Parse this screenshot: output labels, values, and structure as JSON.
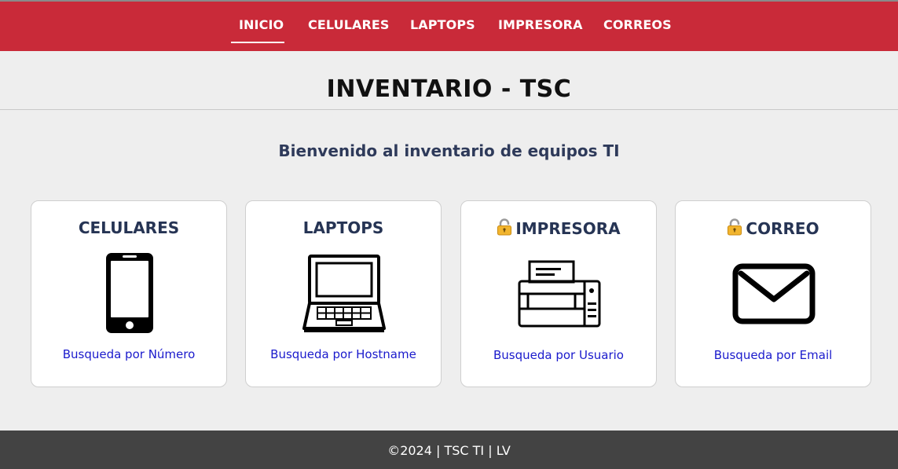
{
  "nav": {
    "items": [
      {
        "label": "INICIO",
        "active": true
      },
      {
        "label": "CELULARES"
      },
      {
        "label": "LAPTOPS"
      },
      {
        "label": "IMPRESORA"
      },
      {
        "label": "CORREOS"
      }
    ]
  },
  "header": {
    "title": "INVENTARIO - TSC"
  },
  "main": {
    "welcome": "Bienvenido al inventario de equipos TI",
    "cards": [
      {
        "title": "CELULARES",
        "icon": "smartphone-icon",
        "link": "Busqueda por Número",
        "locked": false
      },
      {
        "title": "LAPTOPS",
        "icon": "laptop-icon",
        "link": "Busqueda por Hostname",
        "locked": false
      },
      {
        "title": "IMPRESORA",
        "icon": "printer-icon",
        "link": "Busqueda por Usuario",
        "locked": true
      },
      {
        "title": "CORREO",
        "icon": "envelope-icon",
        "link": "Busqueda por Email",
        "locked": true
      }
    ]
  },
  "footer": {
    "text": "©2024 | TSC TI | LV"
  },
  "colors": {
    "topbar": "#c92a39",
    "background": "#eeeeee",
    "card_title": "#263454",
    "link": "#1a1acc",
    "footer": "#434343"
  }
}
